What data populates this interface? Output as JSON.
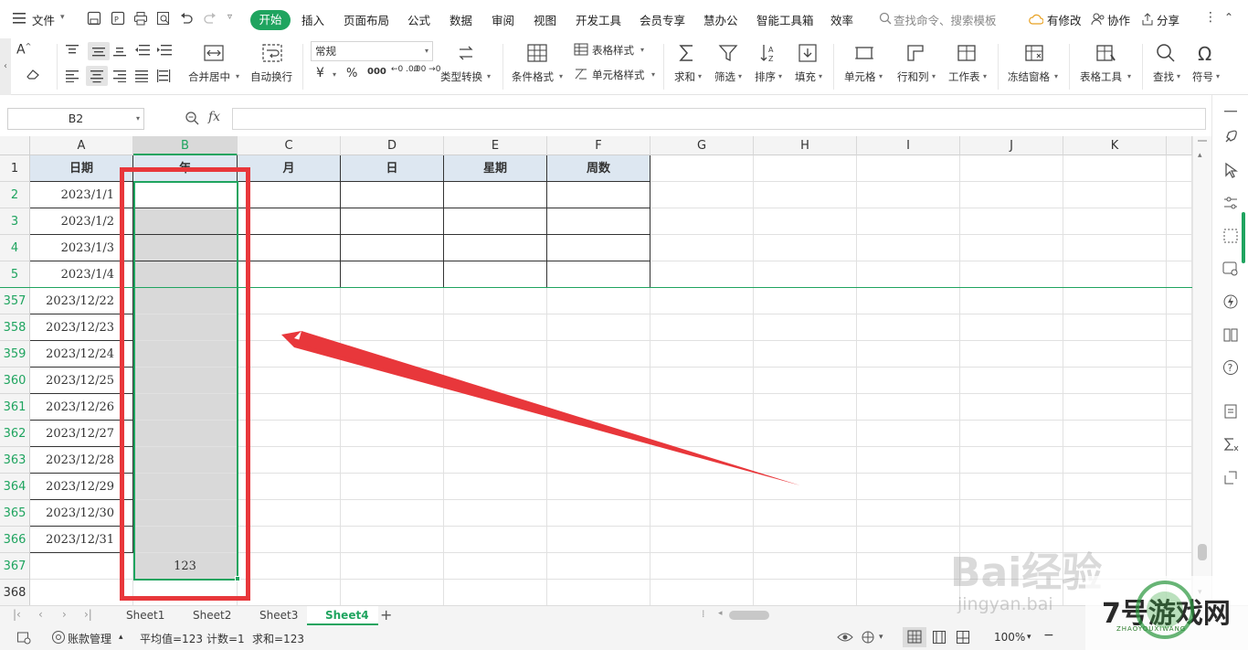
{
  "menubar": {
    "file_label": "文件",
    "tabs": [
      "开始",
      "插入",
      "页面布局",
      "公式",
      "数据",
      "审阅",
      "视图",
      "开发工具",
      "会员专享",
      "慧办公",
      "智能工具箱",
      "效率"
    ],
    "search_placeholder": "查找命令、搜索模板",
    "right_actions": [
      "有修改",
      "协作",
      "分享"
    ]
  },
  "ribbon": {
    "merge_center": "合并居中",
    "wrap_text": "自动换行",
    "number_format": "常规",
    "currency": "¥",
    "percent": "%",
    "thousands": "000",
    "dec_inc": "←0 .00",
    "dec_dec": ".00 →0",
    "type_convert": "类型转换",
    "cond_format": "条件格式",
    "table_style": "表格样式",
    "cell_style": "单元格样式",
    "sum": "求和",
    "filter": "筛选",
    "sort": "排序",
    "fill": "填充",
    "cell": "单元格",
    "row_col": "行和列",
    "worksheet": "工作表",
    "freeze": "冻结窗格",
    "table_tools": "表格工具",
    "find": "查找",
    "symbol": "符号"
  },
  "formulabar": {
    "name_box": "B2",
    "fx": "fx",
    "value": ""
  },
  "grid": {
    "columns": [
      "A",
      "B",
      "C",
      "D",
      "E",
      "F",
      "G",
      "H",
      "I",
      "J",
      "K"
    ],
    "selected_column": "B",
    "header_row": [
      "日期",
      "年",
      "月",
      "日",
      "星期",
      "周数"
    ],
    "rows": [
      {
        "num": "1",
        "a": ""
      },
      {
        "num": "2",
        "a": "2023/1/1"
      },
      {
        "num": "3",
        "a": "2023/1/2"
      },
      {
        "num": "4",
        "a": "2023/1/3"
      },
      {
        "num": "5",
        "a": "2023/1/4"
      },
      {
        "num": "357",
        "a": "2023/12/22"
      },
      {
        "num": "358",
        "a": "2023/12/23"
      },
      {
        "num": "359",
        "a": "2023/12/24"
      },
      {
        "num": "360",
        "a": "2023/12/25"
      },
      {
        "num": "361",
        "a": "2023/12/26"
      },
      {
        "num": "362",
        "a": "2023/12/27"
      },
      {
        "num": "363",
        "a": "2023/12/28"
      },
      {
        "num": "364",
        "a": "2023/12/29"
      },
      {
        "num": "365",
        "a": "2023/12/30"
      },
      {
        "num": "366",
        "a": "2023/12/31"
      },
      {
        "num": "367",
        "a": ""
      },
      {
        "num": "368",
        "a": ""
      }
    ],
    "b367_value": "123"
  },
  "sheets": {
    "tabs": [
      "Sheet1",
      "Sheet2",
      "Sheet3",
      "Sheet4"
    ],
    "active": "Sheet4",
    "add": "+"
  },
  "status": {
    "account": "账款管理",
    "average": "平均值=123",
    "count": "计数=1",
    "sum": "求和=123",
    "zoom": "100%"
  },
  "watermark": {
    "text": "Bai经验",
    "url": "jingyan.bai",
    "logo": "7号游戏网",
    "logo_sub": "ZHAOYOUXIWANG"
  },
  "colors": {
    "accent": "#1fa45f",
    "annotation": "#e8373b",
    "header_fill": "#dde7f1",
    "selection_fill": "#d9d9d9"
  }
}
